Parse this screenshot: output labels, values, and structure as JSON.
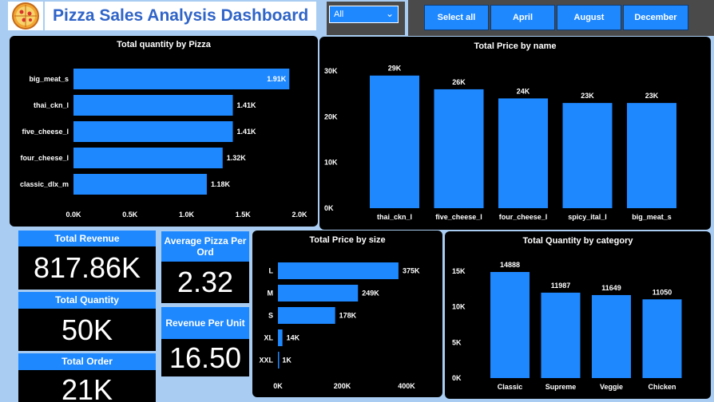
{
  "header": {
    "title": "Pizza Sales Analysis Dashboard",
    "logo_icon": "pizza-icon",
    "dropdown": {
      "selected": "All",
      "icon": "chevron-down-icon"
    },
    "buttons": [
      "Select all",
      "April",
      "August",
      "December"
    ]
  },
  "colors": {
    "bar": "#1e88ff",
    "panel": "#000000",
    "background": "#a9cdf2"
  },
  "kpis": {
    "total_revenue": {
      "label": "Total Revenue",
      "value": "817.86K"
    },
    "total_quantity": {
      "label": "Total Quantity",
      "value": "50K"
    },
    "total_order": {
      "label": "Total Order",
      "value": "21K"
    },
    "avg_pizza": {
      "label": "Average Pizza Per Ord",
      "value": "2.32"
    },
    "revenue_per_unit": {
      "label": "Revenue Per Unit",
      "value": "16.50"
    }
  },
  "chart_data": [
    {
      "id": "qty_by_pizza",
      "type": "bar",
      "orientation": "horizontal",
      "title": "Total quantity by Pizza",
      "categories": [
        "big_meat_s",
        "thai_ckn_l",
        "five_cheese_l",
        "four_cheese_l",
        "classic_dlx_m"
      ],
      "values": [
        1910,
        1410,
        1410,
        1320,
        1180
      ],
      "labels": [
        "1.91K",
        "1.41K",
        "1.41K",
        "1.32K",
        "1.18K"
      ],
      "ticks": [
        "0.0K",
        "0.5K",
        "1.0K",
        "1.5K",
        "2.0K"
      ],
      "xlim": [
        0,
        2000
      ]
    },
    {
      "id": "price_by_name",
      "type": "bar",
      "orientation": "vertical",
      "title": "Total Price by name",
      "categories": [
        "thai_ckn_l",
        "five_cheese_l",
        "four_cheese_l",
        "spicy_ital_l",
        "big_meat_s"
      ],
      "values": [
        29000,
        26000,
        24000,
        23000,
        23000
      ],
      "labels": [
        "29K",
        "26K",
        "24K",
        "23K",
        "23K"
      ],
      "ticks": [
        "0K",
        "10K",
        "20K",
        "30K"
      ],
      "ylim": [
        0,
        30000
      ]
    },
    {
      "id": "price_by_size",
      "type": "bar",
      "orientation": "horizontal",
      "title": "Total Price by size",
      "categories": [
        "L",
        "M",
        "S",
        "XL",
        "XXL"
      ],
      "values": [
        375000,
        249000,
        178000,
        14000,
        1000
      ],
      "labels": [
        "375K",
        "249K",
        "178K",
        "14K",
        "1K"
      ],
      "ticks": [
        "0K",
        "200K",
        "400K"
      ],
      "xlim": [
        0,
        400000
      ]
    },
    {
      "id": "qty_by_category",
      "type": "bar",
      "orientation": "vertical",
      "title": "Total Quantity by category",
      "categories": [
        "Classic",
        "Supreme",
        "Veggie",
        "Chicken"
      ],
      "values": [
        14888,
        11987,
        11649,
        11050
      ],
      "labels": [
        "14888",
        "11987",
        "11649",
        "11050"
      ],
      "ticks": [
        "0K",
        "5K",
        "10K",
        "15K"
      ],
      "ylim": [
        0,
        15000
      ]
    }
  ]
}
